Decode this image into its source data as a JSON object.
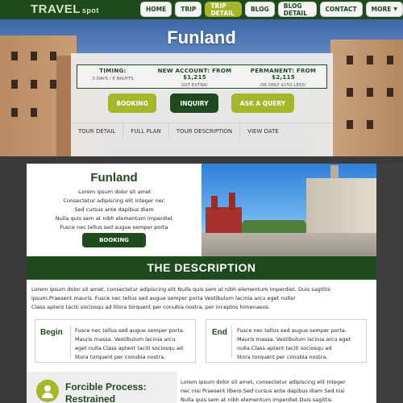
{
  "brand": {
    "logo_main": "TRAVEL",
    "logo_sub": "spot"
  },
  "nav": {
    "items": [
      "HOME",
      "TRIP",
      "TRIP DETAIL",
      "BLOG",
      "BLOG DETAIL",
      "CONTACT",
      "MORE"
    ],
    "active": "TRIP DETAIL"
  },
  "hero": {
    "title": "Funland",
    "info": [
      {
        "heading": "TIMING:",
        "sub": "3 DAYS / 6 NIGHTS"
      },
      {
        "heading": "NEW ACCOUNT: FROM $1,215",
        "sub": "GST EXTRA!"
      },
      {
        "heading": "PERMANENT: FROM $2,115",
        "sub": "OR ONLY $150 LESS!"
      }
    ],
    "buttons": {
      "booking": "BOOKING",
      "inquiry": "INQUIRY",
      "ask": "ASK A QUERY"
    },
    "tabs": [
      "TOUR DETAIL",
      "FULL PLAN",
      "TOUR DESCRIPTION",
      "VIEW DATE"
    ]
  },
  "card": {
    "title": "Funland",
    "lines": [
      "-Lorem ipsum dolor sit amet",
      "Consectetur adipiscing elit integer nec",
      "Sed cursus ante dapibus diam",
      "Nulla quis sem at nibh elementum imperdiet",
      "Fusce nec tellus sed augue semper porta"
    ],
    "booking": "BOOKING"
  },
  "description": {
    "heading": "THE DESCRIPTION",
    "paragraph": [
      "Lorem ipsum dolor sit amet, consectetur adipiscing elit Nulla quis sem at nibh elementum imperdiet. Duis sagittis",
      "ipsum.Praesent mauris. Fusce nec tellus sed augue semper porta Vestibulum lacinia arcu eget nulla!",
      "Class aptent taciti sociosqu ad litora torquent per conubia nostra, per inceptos himenaeos."
    ],
    "begin": {
      "label": "Begin",
      "lines": [
        "Fusce nec tellus sed augue semper porta.",
        "Mauris massa. Vestibulum lacinia arcu",
        "eget nulla.Class aptent taciti sociosqu ad",
        "litora torquent per conubia nostra."
      ]
    },
    "end": {
      "label": "End",
      "lines": [
        "Fusce nec tellus sed augue semper porta.",
        "Mauris massa. Vestibulum lacinia arcu eget",
        "nulla.Class aptent taciti sociosqu ad",
        "litora torquent per conubia nostra."
      ]
    }
  },
  "process": {
    "title_line1": "Forcible Process:",
    "title_line2": "Restrained",
    "lines": [
      "Lorem ipsum dolor sit amet, consectetur adipiscing elit Integer",
      "nec nisi Praesent libero Sed cursus ante dapibus diam Sed nisi",
      "Nulla quis sem at nibh elementum imperdiet Duis sagittis"
    ]
  },
  "colors": {
    "primary": "#1e4a1e",
    "accent": "#a5b62b"
  }
}
